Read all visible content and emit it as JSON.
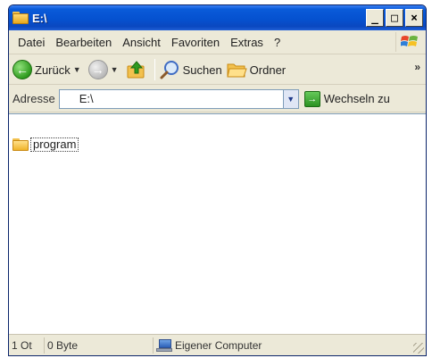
{
  "window": {
    "title": "E:\\"
  },
  "title_buttons": {
    "minimize": "_",
    "maximize": "□",
    "close": "×"
  },
  "menu": {
    "items": [
      "Datei",
      "Bearbeiten",
      "Ansicht",
      "Favoriten",
      "Extras",
      "?"
    ]
  },
  "toolbar": {
    "back_label": "Zurück",
    "search_label": "Suchen",
    "folders_label": "Ordner",
    "more_chevron": "»"
  },
  "address": {
    "label": "Adresse",
    "value": "E:\\",
    "go_label": "Wechseln zu"
  },
  "content": {
    "items": [
      {
        "name": "program",
        "icon": "folder-icon"
      }
    ]
  },
  "status": {
    "objects": "1 Ot",
    "size": "0 Byte",
    "location": "Eigener Computer"
  }
}
